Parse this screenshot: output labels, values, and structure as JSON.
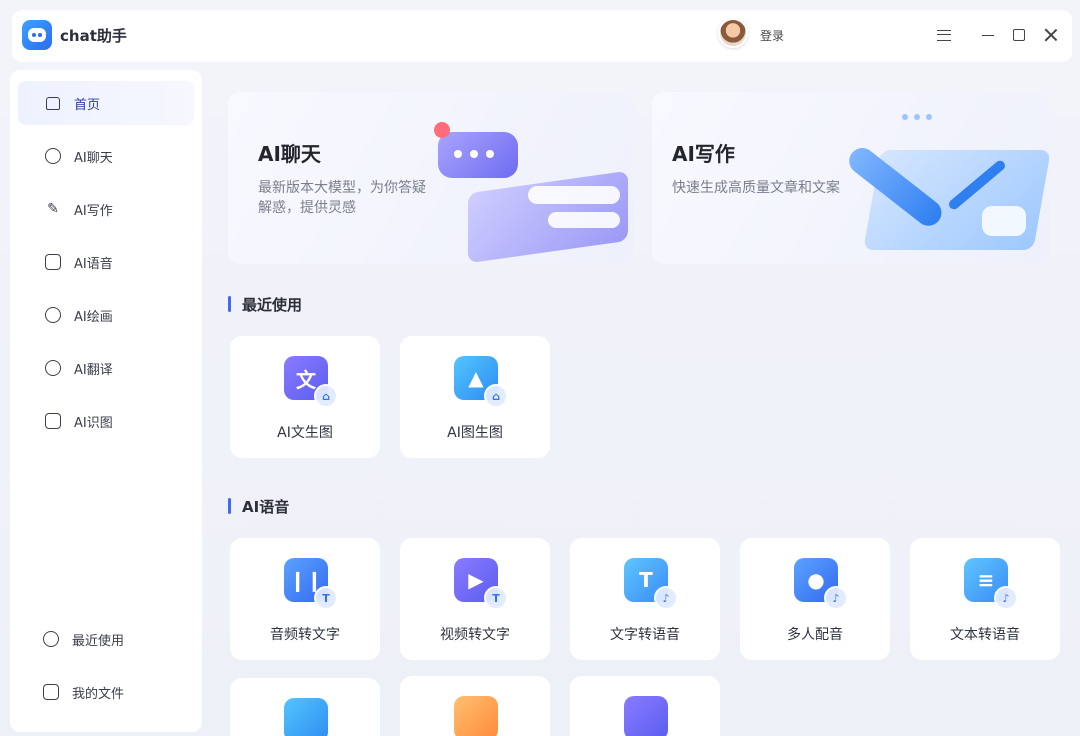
{
  "app": {
    "title": "chat助手",
    "login_label": "登录"
  },
  "sidebar": {
    "items": [
      {
        "label": "首页",
        "icon": "home-icon"
      },
      {
        "label": "AI聊天",
        "icon": "chat-icon"
      },
      {
        "label": "AI写作",
        "icon": "pen-icon"
      },
      {
        "label": "AI语音",
        "icon": "audio-icon"
      },
      {
        "label": "AI绘画",
        "icon": "palette-icon"
      },
      {
        "label": "AI翻译",
        "icon": "translate-icon"
      },
      {
        "label": "AI识图",
        "icon": "scan-icon"
      }
    ],
    "bottom_items": [
      {
        "label": "最近使用",
        "icon": "history-icon"
      },
      {
        "label": "我的文件",
        "icon": "file-icon"
      }
    ]
  },
  "hero": {
    "chat": {
      "title": "AI聊天",
      "desc": "最新版本大模型，为你答疑解惑，提供灵感"
    },
    "write": {
      "title": "AI写作",
      "desc": "快速生成高质量文章和文案"
    }
  },
  "recent": {
    "title": "最近使用",
    "tiles": [
      {
        "label": "AI文生图",
        "icon": "text-to-image-icon"
      },
      {
        "label": "AI图生图",
        "icon": "image-to-image-icon"
      }
    ]
  },
  "voice": {
    "title": "AI语音",
    "tiles": [
      {
        "label": "音频转文字",
        "icon": "audio-to-text-icon"
      },
      {
        "label": "视频转文字",
        "icon": "video-to-text-icon"
      },
      {
        "label": "文字转语音",
        "icon": "text-to-speech-icon"
      },
      {
        "label": "多人配音",
        "icon": "multi-voice-icon"
      },
      {
        "label": "文本转语音",
        "icon": "document-to-speech-icon"
      }
    ]
  },
  "colors": {
    "accent": "#3d6cf2",
    "active_nav_bg": "#eef2ff"
  }
}
